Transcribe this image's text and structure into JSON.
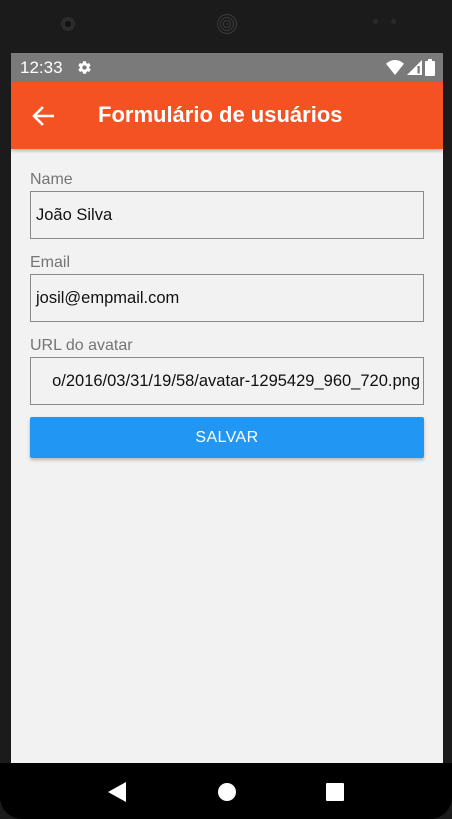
{
  "status_bar": {
    "time": "12:33",
    "icons": [
      "gear-icon",
      "wifi-icon",
      "signal-icon",
      "battery-icon"
    ]
  },
  "app_bar": {
    "title": "Formulário de usuários",
    "back_icon": "arrow-left-icon",
    "color": "#f55223"
  },
  "form": {
    "fields": [
      {
        "label": "Name",
        "value": "João Silva"
      },
      {
        "label": "Email",
        "value": "josil@empmail.com"
      },
      {
        "label": "URL do avatar",
        "value": "o/2016/03/31/19/58/avatar-1295429_960_720.png"
      }
    ],
    "submit_label": "SALVAR",
    "submit_color": "#2196f3"
  },
  "nav_bar": {
    "buttons": [
      "back-triangle-icon",
      "home-circle-icon",
      "recents-square-icon"
    ]
  }
}
